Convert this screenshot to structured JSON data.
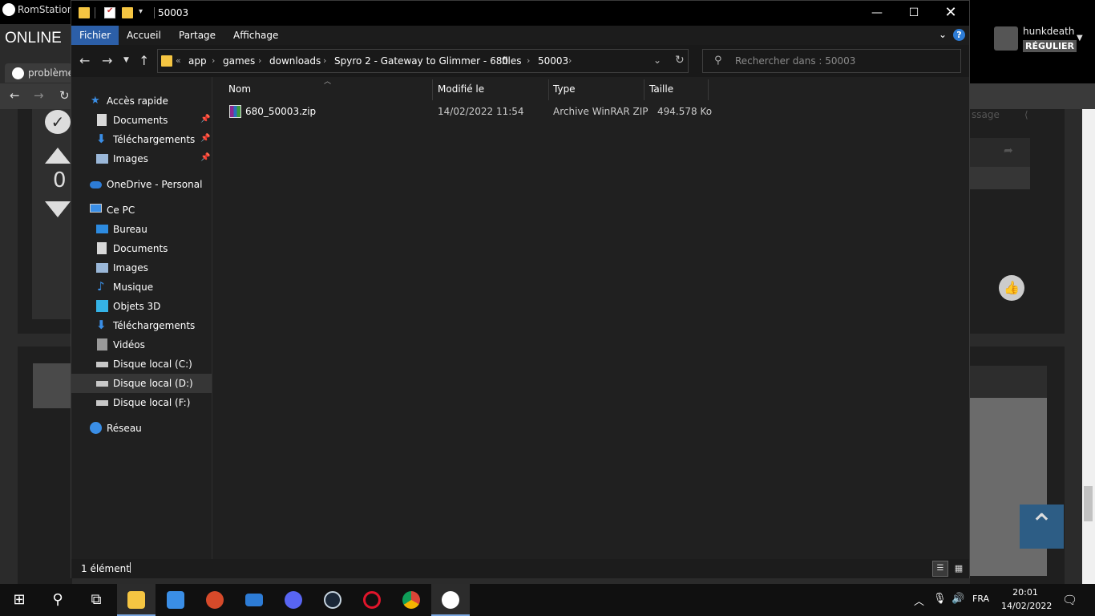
{
  "background_app": {
    "title": "RomStation",
    "online_label": "ONLINE",
    "tab_label": "problème",
    "vote_count": "0",
    "username": "hunkdeath",
    "user_badge": "RÉGULIER",
    "message_hint": "ssage"
  },
  "window": {
    "title": "50003",
    "ribbon_tabs": [
      "Fichier",
      "Accueil",
      "Partage",
      "Affichage"
    ],
    "breadcrumb": [
      "app",
      "games",
      "downloads",
      "Spyro 2 - Gateway to Glimmer - 680",
      "files",
      "50003"
    ],
    "breadcrumb_prefix": "«",
    "search_placeholder": "Rechercher dans : 50003",
    "nav_items": [
      {
        "label": "Accès rapide",
        "icon": "star-icon",
        "color": "#3a8ee6"
      },
      {
        "label": "Documents",
        "icon": "document-icon",
        "color": "#d8d8d8",
        "pinned": true
      },
      {
        "label": "Téléchargements",
        "icon": "download-icon",
        "color": "#3a8ee6",
        "pinned": true
      },
      {
        "label": "Images",
        "icon": "image-icon",
        "color": "#9ab7d8",
        "pinned": true
      },
      {
        "label": "OneDrive - Personal",
        "icon": "cloud-icon",
        "color": "#2d7cd6"
      },
      {
        "label": "Ce PC",
        "icon": "computer-icon",
        "color": "#3a8ee6"
      },
      {
        "label": "Bureau",
        "icon": "desktop-icon",
        "color": "#2d8be0"
      },
      {
        "label": "Documents",
        "icon": "document-icon",
        "color": "#d8d8d8"
      },
      {
        "label": "Images",
        "icon": "image-icon",
        "color": "#9ab7d8"
      },
      {
        "label": "Musique",
        "icon": "music-icon",
        "color": "#3a8ee6"
      },
      {
        "label": "Objets 3D",
        "icon": "cube-icon",
        "color": "#35b3e6"
      },
      {
        "label": "Téléchargements",
        "icon": "download-icon",
        "color": "#3a8ee6"
      },
      {
        "label": "Vidéos",
        "icon": "video-icon",
        "color": "#9a9a9a"
      },
      {
        "label": "Disque local (C:)",
        "icon": "drive-icon",
        "color": "#c8c8c8"
      },
      {
        "label": "Disque local (D:)",
        "icon": "drive-icon",
        "color": "#c8c8c8"
      },
      {
        "label": "Disque local (F:)",
        "icon": "drive-icon",
        "color": "#c8c8c8"
      },
      {
        "label": "Réseau",
        "icon": "network-icon",
        "color": "#3a8ee6"
      }
    ],
    "columns": [
      "Nom",
      "Modifié le",
      "Type",
      "Taille"
    ],
    "files": [
      {
        "name": "680_50003.zip",
        "modified": "14/02/2022 11:54",
        "type": "Archive WinRAR ZIP",
        "size": "494.578 Ko"
      }
    ],
    "status": "1 élément"
  },
  "taskbar": {
    "language": "FRA",
    "time": "20:01",
    "date": "14/02/2022"
  },
  "colors": {
    "accent": "#2c5fa8",
    "folder": "#f5c542",
    "selected_nav": "#363636"
  }
}
